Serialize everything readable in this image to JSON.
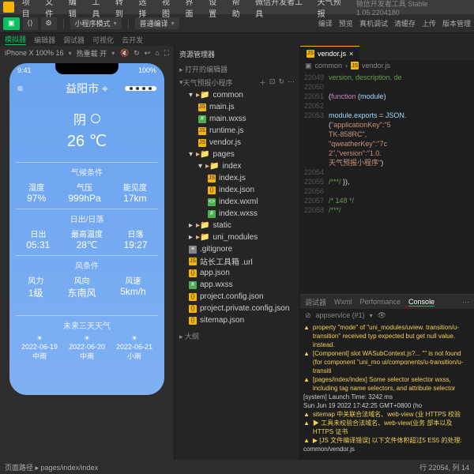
{
  "menu": {
    "items": [
      "项目",
      "文件",
      "编辑",
      "工具",
      "转到",
      "选择",
      "视图",
      "界面",
      "设置",
      "帮助",
      "微信开发者工具",
      "天气预报"
    ],
    "title": "微信开发者工具 Stable 1.05.2204180"
  },
  "toolbar": {
    "modeLabel": "小程序模式",
    "compileLabel": "普通编译",
    "right": [
      "编译",
      "预览",
      "真机调试",
      "清缓存",
      "上传",
      "版本管理"
    ]
  },
  "tabrow": {
    "left": [
      "模拟器",
      "编辑器",
      "调试器",
      "可视化",
      "云开发"
    ]
  },
  "sim": {
    "device": "iPhone X 100% 16",
    "hot": "热重载 开"
  },
  "phone": {
    "time": "9:41",
    "battery": "100%",
    "city": "益阳市",
    "cond": "阴",
    "temp": "26 ℃",
    "sections": [
      {
        "title": "气候条件",
        "items": [
          {
            "lbl": "湿度",
            "val": "97%"
          },
          {
            "lbl": "气压",
            "val": "999hPa"
          },
          {
            "lbl": "能见度",
            "val": "17km"
          }
        ]
      },
      {
        "title": "日出/日落",
        "items": [
          {
            "lbl": "日出",
            "val": "05:31"
          },
          {
            "lbl": "最高温度",
            "val": "28℃"
          },
          {
            "lbl": "日落",
            "val": "19:27"
          }
        ]
      },
      {
        "title": "风条件",
        "items": [
          {
            "lbl": "风力",
            "val": "1级"
          },
          {
            "lbl": "风向",
            "val": "东南风"
          },
          {
            "lbl": "风速",
            "val": "5km/h"
          }
        ]
      }
    ],
    "forecastTitle": "未来三天天气",
    "forecast": [
      {
        "date": "2022-06-19",
        "cond": "中雨"
      },
      {
        "date": "2022-06-20",
        "cond": "中雨"
      },
      {
        "date": "2022-06-21",
        "cond": "小雨"
      }
    ]
  },
  "explorer": {
    "title": "资源管理器",
    "open": "打开的编辑器",
    "project": "天气预报小程序",
    "tree": [
      {
        "t": "folder",
        "n": "common",
        "d": 1,
        "open": true
      },
      {
        "t": "js",
        "n": "main.js",
        "d": 2
      },
      {
        "t": "wxss",
        "n": "main.wxss",
        "d": 2
      },
      {
        "t": "js",
        "n": "runtime.js",
        "d": 2
      },
      {
        "t": "js",
        "n": "vendor.js",
        "d": 2
      },
      {
        "t": "folder",
        "n": "pages",
        "d": 1,
        "open": true
      },
      {
        "t": "folder",
        "n": "index",
        "d": 2,
        "open": true
      },
      {
        "t": "js",
        "n": "index.js",
        "d": 3
      },
      {
        "t": "json",
        "n": "index.json",
        "d": 3
      },
      {
        "t": "wxml",
        "n": "index.wxml",
        "d": 3
      },
      {
        "t": "wxss",
        "n": "index.wxss",
        "d": 3
      },
      {
        "t": "folder",
        "n": "static",
        "d": 1
      },
      {
        "t": "folder",
        "n": "uni_modules",
        "d": 1
      },
      {
        "t": "file",
        "n": ".gitignore",
        "d": 1
      },
      {
        "t": "js",
        "n": "站长工具箱 .url",
        "d": 1
      },
      {
        "t": "json",
        "n": "app.json",
        "d": 1
      },
      {
        "t": "wxss",
        "n": "app.wxss",
        "d": 1
      },
      {
        "t": "json",
        "n": "project.config.json",
        "d": 1
      },
      {
        "t": "json",
        "n": "project.private.config.json",
        "d": 1
      },
      {
        "t": "json",
        "n": "sitemap.json",
        "d": 1
      }
    ],
    "outline": "大纲"
  },
  "editor": {
    "tab": "vendor.js",
    "crumb": [
      "common",
      "vendor.js"
    ],
    "lines": [
      {
        "no": "22049",
        "txt": [
          {
            "c": "cmt",
            "t": "version, description, de"
          }
        ]
      },
      {
        "no": "22050",
        "txt": []
      },
      {
        "no": "22051",
        "txt": [
          {
            "c": "op",
            "t": "("
          },
          {
            "c": "kw",
            "t": "function"
          },
          {
            "c": "op",
            "t": " ("
          },
          {
            "c": "var",
            "t": "module"
          },
          {
            "c": "op",
            "t": ") "
          }
        ]
      },
      {
        "no": "22052",
        "txt": []
      },
      {
        "no": "22053",
        "txt": [
          {
            "c": "var",
            "t": "module"
          },
          {
            "c": "op",
            "t": "."
          },
          {
            "c": "var",
            "t": "exports"
          },
          {
            "c": "op",
            "t": " = "
          },
          {
            "c": "var",
            "t": "JSON."
          }
        ]
      },
      {
        "no": "",
        "txt": [
          {
            "c": "op",
            "t": "("
          },
          {
            "c": "str",
            "t": "\"applicationKey\":\"5"
          }
        ]
      },
      {
        "no": "",
        "txt": [
          {
            "c": "str",
            "t": "TK-858RC\","
          }
        ]
      },
      {
        "no": "",
        "txt": [
          {
            "c": "str",
            "t": "\"qweatherKey\":\"7c"
          }
        ]
      },
      {
        "no": "",
        "txt": [
          {
            "c": "str",
            "t": "2\",\"version\":\"1.0."
          }
        ]
      },
      {
        "no": "",
        "txt": [
          {
            "c": "str",
            "t": "天气预报小程序\""
          },
          {
            "c": "op",
            "t": ")"
          }
        ]
      },
      {
        "no": "22054",
        "txt": []
      },
      {
        "no": "22055",
        "txt": [
          {
            "c": "cmt",
            "t": "/***/"
          },
          {
            "c": "op",
            "t": " }),"
          }
        ]
      },
      {
        "no": "22056",
        "txt": []
      },
      {
        "no": "22057",
        "txt": [
          {
            "c": "cmt",
            "t": "/* 148 */"
          }
        ]
      },
      {
        "no": "22058",
        "txt": [
          {
            "c": "cmt",
            "t": "/***/"
          }
        ]
      }
    ]
  },
  "console": {
    "tabs": [
      "调试器",
      "Wxml",
      "Performance",
      "Console"
    ],
    "filter": "appservice (#1)",
    "lines": [
      {
        "k": "warn",
        "t": "property \"mode\" of \"uni_modules/uview. transition/u-transition\" received typ expected <String> but get null value. instead."
      },
      {
        "k": "warn",
        "t": "[Component] slot    WASubContext.js?... \"\" is not found (for component \"uni_mo ui/components/u-transition/u-transiti"
      },
      {
        "k": "warn",
        "t": "[pages/index/index] Some selector selector wxss, including tag name selectors, and attribute selector"
      },
      {
        "k": "info",
        "t": "[system] Launch Time: 3242 ms"
      },
      {
        "k": "info",
        "t": "Sun Jun 19 2022 17:42:25 GMT+0800 (ho"
      },
      {
        "k": "warn",
        "t": "sitemap 中关联合法域名、web-view (业 HTTPS 校验"
      },
      {
        "k": "warn",
        "t": "▶ 工具未校验合法域名、web-view(业务 部本以及 HTTPS 证书"
      },
      {
        "k": "warn",
        "t": "▶ [JS 文件编译错误] 以下文件体积超过5 ES5 的处理:"
      },
      {
        "k": "info",
        "t": "common/vendor.js"
      }
    ]
  },
  "footer": {
    "left": "页面路径 ▸ pages/index/index",
    "right": "行 22054, 列 14"
  }
}
